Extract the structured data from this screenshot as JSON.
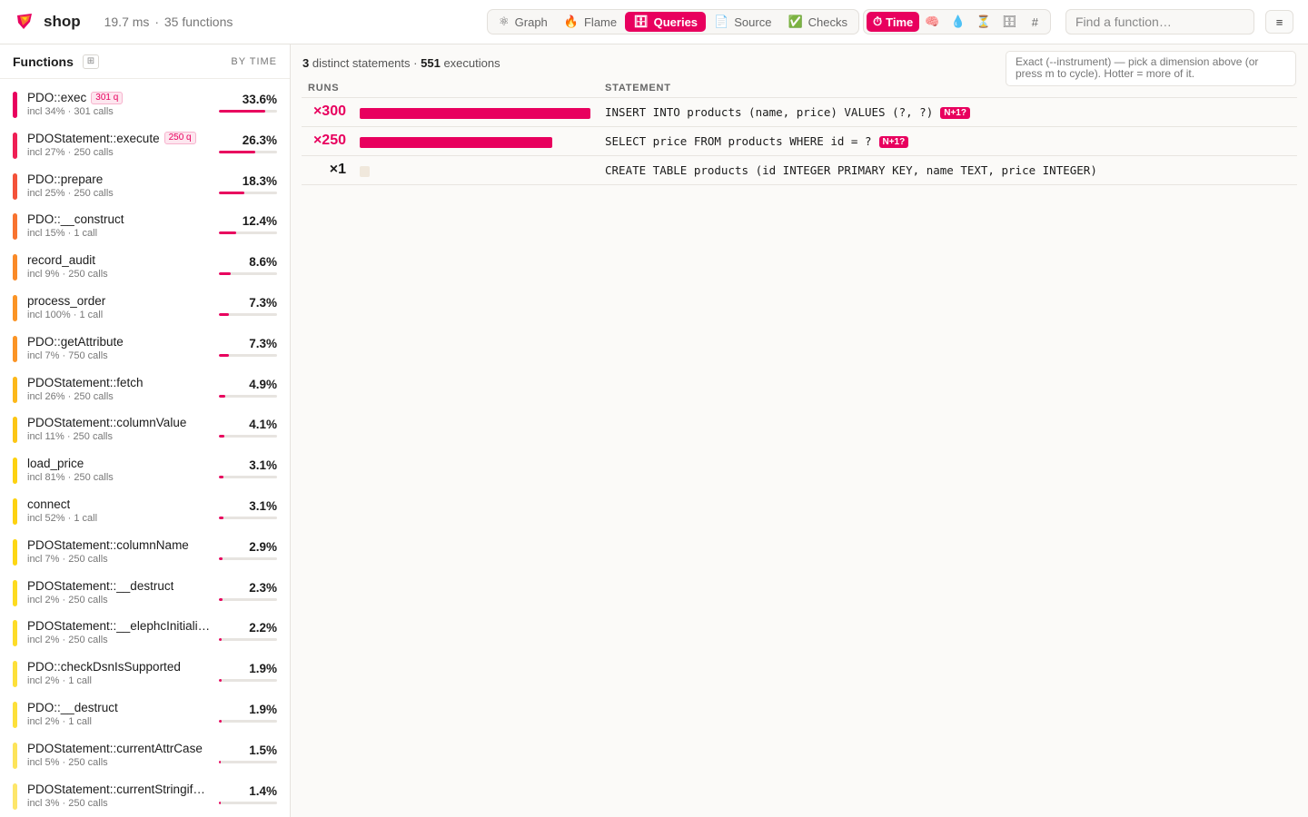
{
  "header": {
    "app_name": "shop",
    "duration": "19.7 ms",
    "separator": "·",
    "functions_count": "35 functions",
    "views": [
      {
        "label": "Graph",
        "icon": "⚛",
        "active": false
      },
      {
        "label": "Flame",
        "icon": "🔥",
        "active": false
      },
      {
        "label": "Queries",
        "icon": "🗄",
        "active": true
      },
      {
        "label": "Source",
        "icon": "📄",
        "active": false
      },
      {
        "label": "Checks",
        "icon": "✅",
        "active": false
      }
    ],
    "dimensions": [
      {
        "label": "Time",
        "icon": "⏱",
        "active": true
      },
      {
        "label": "",
        "icon": "🧠",
        "active": false
      },
      {
        "label": "",
        "icon": "💧",
        "active": false
      },
      {
        "label": "",
        "icon": "⏳",
        "active": false
      },
      {
        "label": "",
        "icon": "🗄",
        "active": false
      },
      {
        "label": "",
        "icon": "#",
        "active": false
      }
    ],
    "search_placeholder": "Find a function…",
    "menu_icon": "≡"
  },
  "sidebar": {
    "title": "Functions",
    "sort_label": "BY TIME",
    "items": [
      {
        "name": "PDO::exec",
        "badge": "301 q",
        "sub": "incl 34% · 301 calls",
        "pct": "33.6%",
        "value": 33.6,
        "color": "#e8005e"
      },
      {
        "name": "PDOStatement::execute",
        "badge": "250 q",
        "sub": "incl 27% · 250 calls",
        "pct": "26.3%",
        "value": 26.3,
        "color": "#ef1f55"
      },
      {
        "name": "PDO::prepare",
        "badge": "",
        "sub": "incl 25% · 250 calls",
        "pct": "18.3%",
        "value": 18.3,
        "color": "#f4523a"
      },
      {
        "name": "PDO::__construct",
        "badge": "",
        "sub": "incl 15% · 1 call",
        "pct": "12.4%",
        "value": 12.4,
        "color": "#f87330"
      },
      {
        "name": "record_audit",
        "badge": "",
        "sub": "incl 9% · 250 calls",
        "pct": "8.6%",
        "value": 8.6,
        "color": "#fa8a28"
      },
      {
        "name": "process_order",
        "badge": "",
        "sub": "incl 100% · 1 call",
        "pct": "7.3%",
        "value": 7.3,
        "color": "#fb9425"
      },
      {
        "name": "PDO::getAttribute",
        "badge": "",
        "sub": "incl 7% · 750 calls",
        "pct": "7.3%",
        "value": 7.3,
        "color": "#fb9425"
      },
      {
        "name": "PDOStatement::fetch",
        "badge": "",
        "sub": "incl 26% · 250 calls",
        "pct": "4.9%",
        "value": 4.9,
        "color": "#fcb81a"
      },
      {
        "name": "PDOStatement::columnValue",
        "badge": "",
        "sub": "incl 11% · 250 calls",
        "pct": "4.1%",
        "value": 4.1,
        "color": "#fcc615"
      },
      {
        "name": "load_price",
        "badge": "",
        "sub": "incl 81% · 250 calls",
        "pct": "3.1%",
        "value": 3.1,
        "color": "#fdd211"
      },
      {
        "name": "connect",
        "badge": "",
        "sub": "incl 52% · 1 call",
        "pct": "3.1%",
        "value": 3.1,
        "color": "#fdd211"
      },
      {
        "name": "PDOStatement::columnName",
        "badge": "",
        "sub": "incl 7% · 250 calls",
        "pct": "2.9%",
        "value": 2.9,
        "color": "#fdd714"
      },
      {
        "name": "PDOStatement::__destruct",
        "badge": "",
        "sub": "incl 2% · 250 calls",
        "pct": "2.3%",
        "value": 2.3,
        "color": "#fddb20"
      },
      {
        "name": "PDOStatement::__elephcInitiali…",
        "badge": "",
        "sub": "incl 2% · 250 calls",
        "pct": "2.2%",
        "value": 2.2,
        "color": "#fddc28"
      },
      {
        "name": "PDO::checkDsnIsSupported",
        "badge": "",
        "sub": "incl 2% · 1 call",
        "pct": "1.9%",
        "value": 1.9,
        "color": "#fde03a"
      },
      {
        "name": "PDO::__destruct",
        "badge": "",
        "sub": "incl 2% · 1 call",
        "pct": "1.9%",
        "value": 1.9,
        "color": "#fde03a"
      },
      {
        "name": "PDOStatement::currentAttrCase",
        "badge": "",
        "sub": "incl 5% · 250 calls",
        "pct": "1.5%",
        "value": 1.5,
        "color": "#fde45a"
      },
      {
        "name": "PDOStatement::currentStringif…",
        "badge": "",
        "sub": "incl 3% · 250 calls",
        "pct": "1.4%",
        "value": 1.4,
        "color": "#fde66a"
      }
    ]
  },
  "main": {
    "summary_distinct": "3",
    "summary_distinct_label": "distinct statements",
    "summary_sep": "·",
    "summary_exec": "551",
    "summary_exec_label": "executions",
    "hint": "Exact (--instrument) — pick a dimension above (or press m to cycle). Hotter = more of it.",
    "columns": {
      "runs": "RUNS",
      "statement": "STATEMENT"
    },
    "queries": [
      {
        "runs": "×300",
        "count": 300,
        "statement": "INSERT INTO products (name, price) VALUES (?, ?)",
        "badge": "N+1?"
      },
      {
        "runs": "×250",
        "count": 250,
        "statement": "SELECT price FROM products WHERE id = ?",
        "badge": "N+1?"
      },
      {
        "runs": "×1",
        "count": 1,
        "statement": "CREATE TABLE products (id INTEGER PRIMARY KEY, name TEXT, price INTEGER)",
        "badge": ""
      }
    ]
  }
}
